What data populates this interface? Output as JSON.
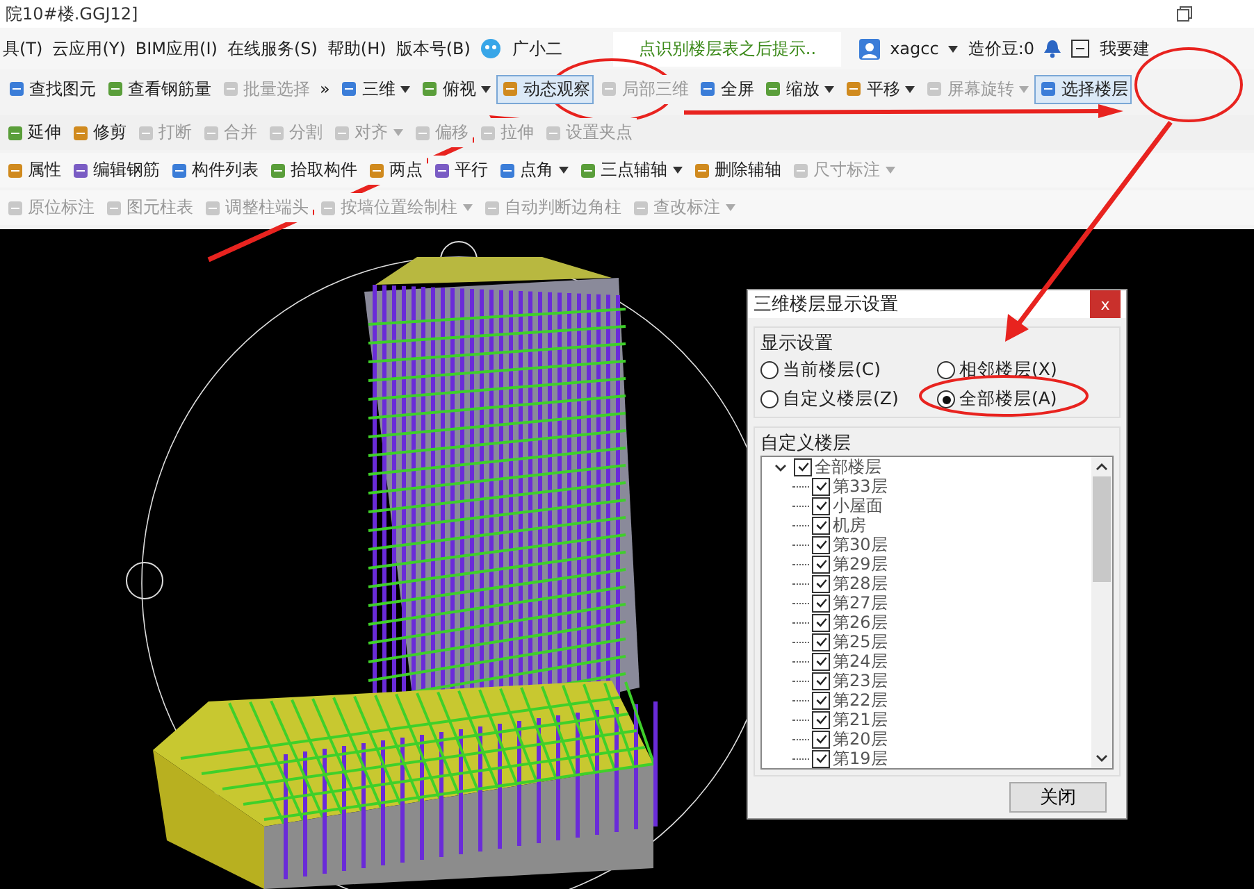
{
  "window": {
    "title": "院10#楼.GGJ12]"
  },
  "menu_bar": {
    "items": [
      "具(T)",
      "云应用(Y)",
      "BIM应用(I)",
      "在线服务(S)",
      "帮助(H)",
      "版本号(B)"
    ],
    "assistant": "广小二",
    "notice": "点识别楼层表之后提示..",
    "user": "xagcc",
    "balance": "造价豆:0",
    "help": "我要建"
  },
  "toolbars": [
    [
      {
        "label": "查找图元",
        "disabled": false,
        "dropdown": false,
        "selected": false
      },
      {
        "label": "查看钢筋量",
        "disabled": false,
        "dropdown": false,
        "selected": false
      },
      {
        "label": "批量选择",
        "disabled": true,
        "dropdown": false,
        "selected": false
      },
      {
        "label": "»",
        "disabled": false,
        "dropdown": false,
        "selected": false,
        "kind": "more"
      },
      {
        "label": "三维",
        "disabled": false,
        "dropdown": true,
        "selected": false
      },
      {
        "label": "俯视",
        "disabled": false,
        "dropdown": true,
        "selected": false
      },
      {
        "label": "动态观察",
        "disabled": false,
        "dropdown": false,
        "selected": true
      },
      {
        "label": "局部三维",
        "disabled": true,
        "dropdown": false,
        "selected": false
      },
      {
        "label": "全屏",
        "disabled": false,
        "dropdown": false,
        "selected": false
      },
      {
        "label": "缩放",
        "disabled": false,
        "dropdown": true,
        "selected": false
      },
      {
        "label": "平移",
        "disabled": false,
        "dropdown": true,
        "selected": false
      },
      {
        "label": "屏幕旋转",
        "disabled": true,
        "dropdown": true,
        "selected": false
      },
      {
        "label": "选择楼层",
        "disabled": false,
        "dropdown": false,
        "selected": true
      }
    ],
    [
      {
        "label": "延伸",
        "disabled": false,
        "dropdown": false,
        "selected": false
      },
      {
        "label": "修剪",
        "disabled": false,
        "dropdown": false,
        "selected": false
      },
      {
        "label": "打断",
        "disabled": true,
        "dropdown": false,
        "selected": false
      },
      {
        "label": "合并",
        "disabled": true,
        "dropdown": false,
        "selected": false
      },
      {
        "label": "分割",
        "disabled": true,
        "dropdown": false,
        "selected": false
      },
      {
        "label": "对齐",
        "disabled": true,
        "dropdown": true,
        "selected": false
      },
      {
        "label": "偏移",
        "disabled": true,
        "dropdown": false,
        "selected": false
      },
      {
        "label": "拉伸",
        "disabled": true,
        "dropdown": false,
        "selected": false
      },
      {
        "label": "设置夹点",
        "disabled": true,
        "dropdown": false,
        "selected": false
      }
    ],
    [
      {
        "label": "属性",
        "disabled": false,
        "dropdown": false,
        "selected": false
      },
      {
        "label": "编辑钢筋",
        "disabled": false,
        "dropdown": false,
        "selected": false
      },
      {
        "label": "构件列表",
        "disabled": false,
        "dropdown": false,
        "selected": false
      },
      {
        "label": "拾取构件",
        "disabled": false,
        "dropdown": false,
        "selected": false
      },
      {
        "label": "两点",
        "disabled": false,
        "dropdown": false,
        "selected": false
      },
      {
        "label": "平行",
        "disabled": false,
        "dropdown": false,
        "selected": false
      },
      {
        "label": "点角",
        "disabled": false,
        "dropdown": true,
        "selected": false
      },
      {
        "label": "三点辅轴",
        "disabled": false,
        "dropdown": true,
        "selected": false
      },
      {
        "label": "删除辅轴",
        "disabled": false,
        "dropdown": false,
        "selected": false
      },
      {
        "label": "尺寸标注",
        "disabled": true,
        "dropdown": true,
        "selected": false
      }
    ],
    [
      {
        "label": "原位标注",
        "disabled": true,
        "dropdown": false,
        "selected": false
      },
      {
        "label": "图元柱表",
        "disabled": true,
        "dropdown": false,
        "selected": false
      },
      {
        "label": "调整柱端头",
        "disabled": true,
        "dropdown": false,
        "selected": false
      },
      {
        "label": "按墙位置绘制柱",
        "disabled": true,
        "dropdown": true,
        "selected": false
      },
      {
        "label": "自动判断边角柱",
        "disabled": true,
        "dropdown": false,
        "selected": false
      },
      {
        "label": "查改标注",
        "disabled": true,
        "dropdown": true,
        "selected": false
      }
    ]
  ],
  "dialog": {
    "title": "三维楼层显示设置",
    "close": "x",
    "display_group": {
      "title": "显示设置",
      "options": [
        {
          "label": "当前楼层(C)",
          "selected": false
        },
        {
          "label": "相邻楼层(X)",
          "selected": false
        },
        {
          "label": "自定义楼层(Z)",
          "selected": false
        },
        {
          "label": "全部楼层(A)",
          "selected": true
        }
      ]
    },
    "floor_group": {
      "title": "自定义楼层",
      "tree": {
        "label": "全部楼层",
        "checked": true,
        "expanded": true,
        "children": [
          {
            "label": "第33层",
            "checked": true
          },
          {
            "label": "小屋面",
            "checked": true
          },
          {
            "label": "机房",
            "checked": true
          },
          {
            "label": "第30层",
            "checked": true
          },
          {
            "label": "第29层",
            "checked": true
          },
          {
            "label": "第28层",
            "checked": true
          },
          {
            "label": "第27层",
            "checked": true
          },
          {
            "label": "第26层",
            "checked": true
          },
          {
            "label": "第25层",
            "checked": true
          },
          {
            "label": "第24层",
            "checked": true
          },
          {
            "label": "第23层",
            "checked": true
          },
          {
            "label": "第22层",
            "checked": true
          },
          {
            "label": "第21层",
            "checked": true
          },
          {
            "label": "第20层",
            "checked": true
          },
          {
            "label": "第19层",
            "checked": true
          }
        ]
      }
    },
    "button": "关闭"
  }
}
